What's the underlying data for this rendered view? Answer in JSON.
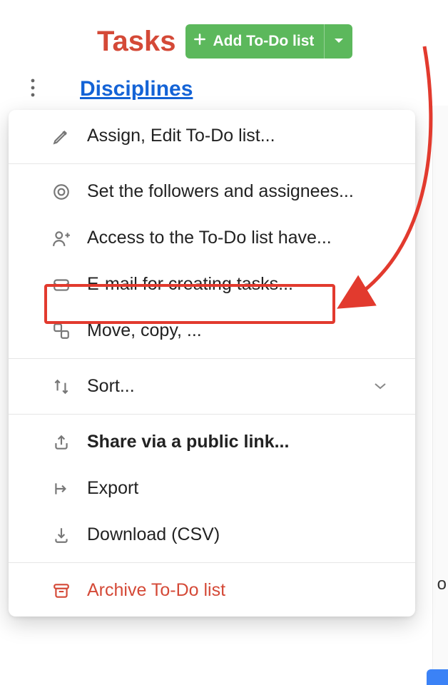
{
  "header": {
    "title": "Tasks",
    "add_button_label": "Add To-Do list"
  },
  "list": {
    "name": "Disciplines"
  },
  "menu": {
    "items": [
      {
        "key": "assign",
        "label": "Assign, Edit To-Do list...",
        "icon": "pencil-icon"
      },
      {
        "key": "followers",
        "label": "Set the followers and assignees...",
        "icon": "eye-icon"
      },
      {
        "key": "access",
        "label": "Access to the To-Do list have...",
        "icon": "user-plus-icon"
      },
      {
        "key": "email",
        "label": "E-mail for creating tasks...",
        "icon": "mail-icon"
      },
      {
        "key": "move",
        "label": "Move, copy, ...",
        "icon": "move-icon"
      },
      {
        "key": "sort",
        "label": "Sort...",
        "icon": "sort-icon"
      },
      {
        "key": "share",
        "label": "Share via a public link...",
        "icon": "share-icon"
      },
      {
        "key": "export",
        "label": "Export",
        "icon": "export-icon"
      },
      {
        "key": "download",
        "label": "Download (CSV)",
        "icon": "download-icon"
      },
      {
        "key": "archive",
        "label": "Archive To-Do list",
        "icon": "archive-icon"
      }
    ]
  },
  "bg_fragment": "o l",
  "annotation": {
    "highlighted_item_key": "email",
    "accent_color": "#e23a2e"
  },
  "colors": {
    "primary_red": "#d44937",
    "button_green": "#5cb85c",
    "link_blue": "#1463d6"
  }
}
